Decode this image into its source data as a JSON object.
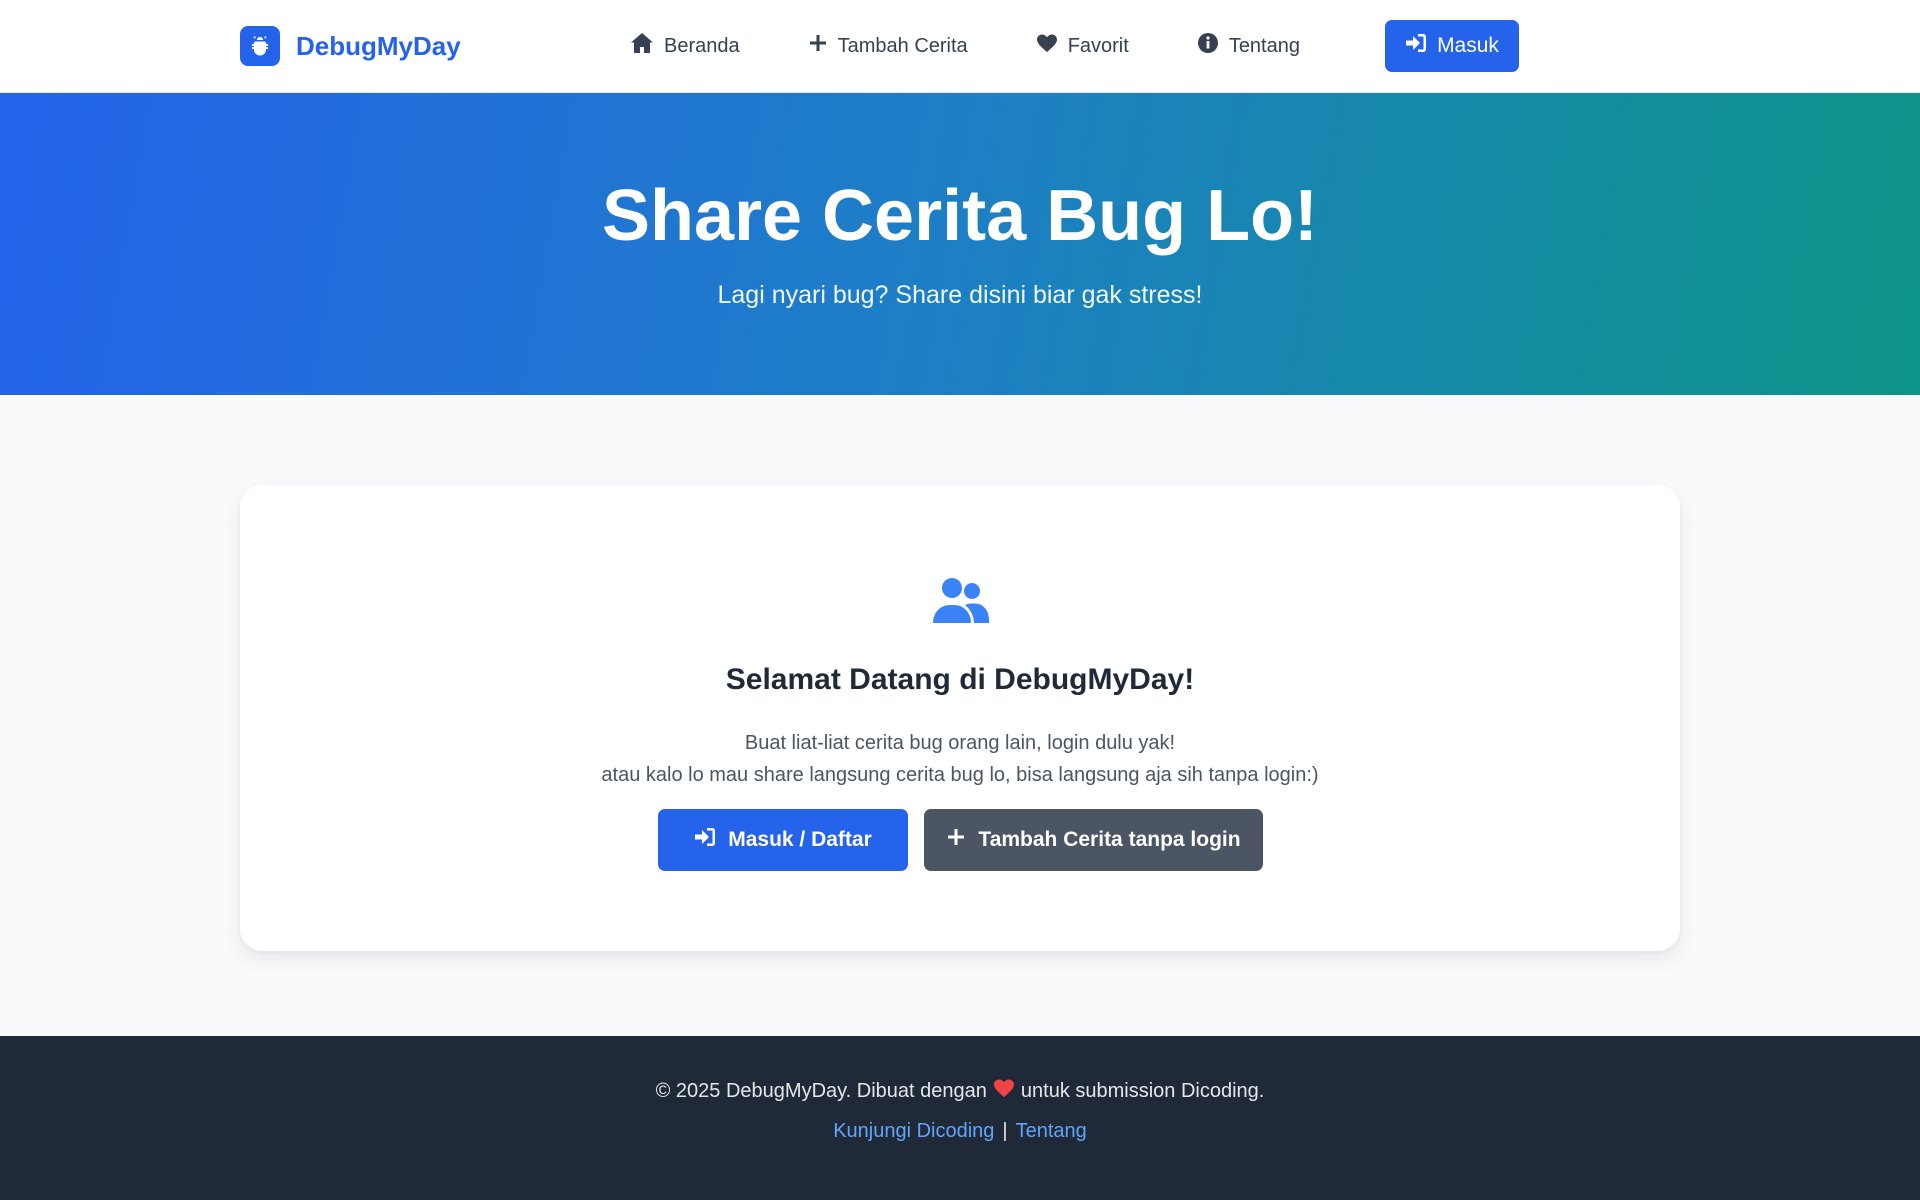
{
  "colors": {
    "primary": "#2563eb",
    "secondary": "#4b5563",
    "hero_gradient_start": "#2563eb",
    "hero_gradient_end": "#0d9488",
    "footer_bg": "#1f2937",
    "heart": "#ef4444",
    "link": "#60a5fa"
  },
  "header": {
    "brand": {
      "name": "DebugMyDay",
      "icon": "bug-icon"
    },
    "nav": [
      {
        "label": "Beranda",
        "icon": "home-icon"
      },
      {
        "label": "Tambah Cerita",
        "icon": "plus-icon"
      },
      {
        "label": "Favorit",
        "icon": "heart-icon"
      },
      {
        "label": "Tentang",
        "icon": "info-icon"
      }
    ],
    "login": {
      "label": "Masuk",
      "icon": "sign-in-icon"
    }
  },
  "hero": {
    "title": "Share Cerita Bug Lo!",
    "subtitle": "Lagi nyari bug? Share disini biar gak stress!"
  },
  "welcome_card": {
    "icon": "users-icon",
    "title": "Selamat Datang di DebugMyDay!",
    "line1": "Buat liat-liat cerita bug orang lain, login dulu yak!",
    "line2": "atau kalo lo mau share langsung cerita bug lo, bisa langsung aja sih tanpa login:)",
    "primary_button": {
      "label": "Masuk / Daftar",
      "icon": "sign-in-icon"
    },
    "secondary_button": {
      "label": "Tambah Cerita tanpa login",
      "icon": "plus-icon"
    }
  },
  "footer": {
    "text_before": "© 2025 DebugMyDay. Dibuat dengan",
    "text_after": "untuk submission Dicoding.",
    "heart_icon": "heart-icon",
    "links": [
      {
        "label": "Kunjungi Dicoding"
      },
      {
        "label": "Tentang"
      }
    ],
    "separator": "|"
  }
}
